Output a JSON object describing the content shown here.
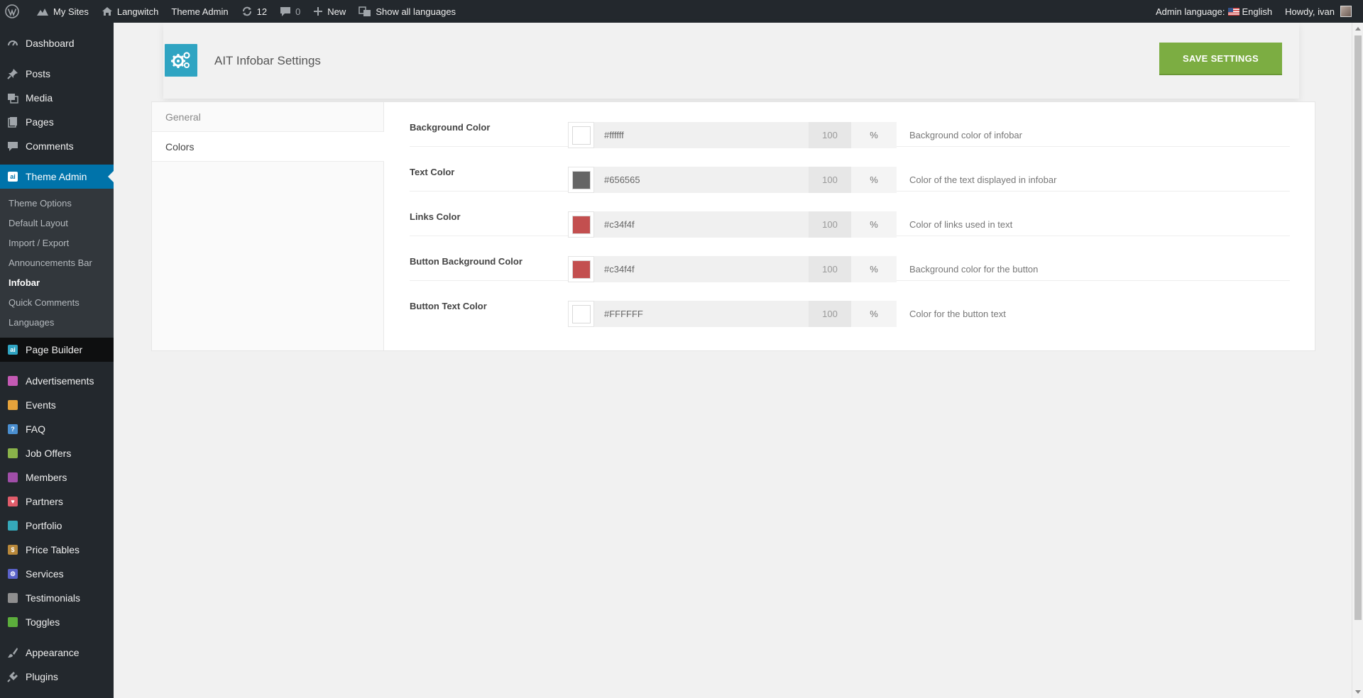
{
  "adminbar": {
    "wp_logo": "wordpress-icon",
    "my_sites": "My Sites",
    "site_name": "Langwitch",
    "theme_admin": "Theme Admin",
    "updates_count": "12",
    "comments_count": "0",
    "new_label": "New",
    "languages_label": "Show all languages",
    "admin_language_label": "Admin language:",
    "admin_language_value": "English",
    "howdy": "Howdy, ivan"
  },
  "sidebar": {
    "top_items": [
      {
        "label": "Dashboard",
        "icon": "dashboard-icon"
      },
      {
        "label": "Posts",
        "icon": "pin-icon"
      },
      {
        "label": "Media",
        "icon": "media-icon"
      },
      {
        "label": "Pages",
        "icon": "pages-icon"
      },
      {
        "label": "Comments",
        "icon": "comment-icon"
      }
    ],
    "current": {
      "label": "Theme Admin",
      "icon": "ait-icon"
    },
    "submenu": [
      {
        "label": "Theme Options"
      },
      {
        "label": "Default Layout"
      },
      {
        "label": "Import / Export"
      },
      {
        "label": "Announcements Bar"
      },
      {
        "label": "Infobar"
      },
      {
        "label": "Quick Comments"
      },
      {
        "label": "Languages"
      }
    ],
    "page_builder": "Page Builder",
    "cpt_items": [
      {
        "label": "Advertisements",
        "color": "#c45ab4"
      },
      {
        "label": "Events",
        "color": "#e6a33b"
      },
      {
        "label": "FAQ",
        "color": "#4a8fd0"
      },
      {
        "label": "Job Offers",
        "color": "#8ab34a"
      },
      {
        "label": "Members",
        "color": "#a04ea8"
      },
      {
        "label": "Partners",
        "color": "#e05c6a"
      },
      {
        "label": "Portfolio",
        "color": "#35a8b9"
      },
      {
        "label": "Price Tables",
        "color": "#b8883a"
      },
      {
        "label": "Services",
        "color": "#5a62c9"
      },
      {
        "label": "Testimonials",
        "color": "#8f8f8f"
      },
      {
        "label": "Toggles",
        "color": "#5cae3c"
      }
    ],
    "bottom_items": [
      {
        "label": "Appearance",
        "icon": "brush-icon"
      },
      {
        "label": "Plugins",
        "icon": "plugin-icon"
      }
    ]
  },
  "header": {
    "title": "AIT Infobar Settings",
    "save_label": "SAVE SETTINGS",
    "logo_color": "#2fa4c2",
    "save_color": "#7cad42"
  },
  "tabs": [
    {
      "label": "General",
      "active": false
    },
    {
      "label": "Colors",
      "active": true
    }
  ],
  "colors": [
    {
      "label": "Background Color",
      "hex": "#ffffff",
      "opacity": "100",
      "unit": "%",
      "description": "Background color of infobar"
    },
    {
      "label": "Text Color",
      "hex": "#656565",
      "opacity": "100",
      "unit": "%",
      "description": "Color of the text displayed in infobar"
    },
    {
      "label": "Links Color",
      "hex": "#c34f4f",
      "opacity": "100",
      "unit": "%",
      "description": "Color of links used in text"
    },
    {
      "label": "Button Background Color",
      "hex": "#c34f4f",
      "opacity": "100",
      "unit": "%",
      "description": "Background color for the button"
    },
    {
      "label": "Button Text Color",
      "hex": "#FFFFFF",
      "opacity": "100",
      "unit": "%",
      "description": "Color for the button text"
    }
  ]
}
